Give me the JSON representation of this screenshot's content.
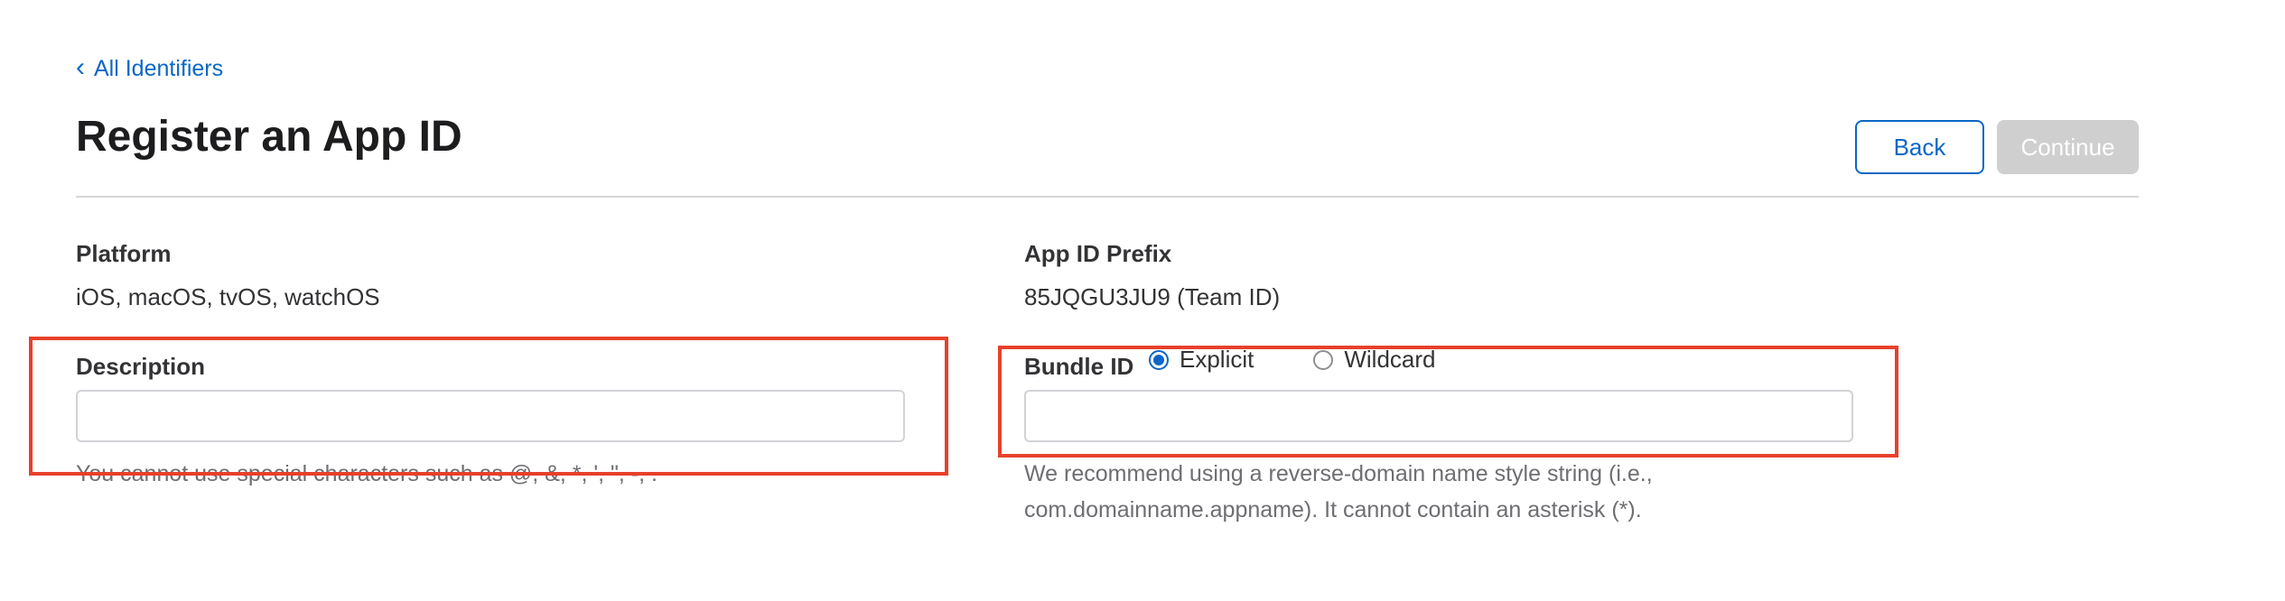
{
  "nav": {
    "back_link": "All Identifiers",
    "chevron": "‹"
  },
  "page": {
    "title": "Register an App ID"
  },
  "actions": {
    "back_label": "Back",
    "continue_label": "Continue"
  },
  "platform": {
    "label": "Platform",
    "value": "iOS, macOS, tvOS, watchOS"
  },
  "app_id_prefix": {
    "label": "App ID Prefix",
    "value": "85JQGU3JU9 (Team ID)"
  },
  "description": {
    "label": "Description",
    "value": "",
    "hint": "You cannot use special characters such as @, &, *, ', \", -, ."
  },
  "bundle_id": {
    "label": "Bundle ID",
    "options": [
      "Explicit",
      "Wildcard"
    ],
    "selected": "Explicit",
    "value": "",
    "hint_line1": "We recommend using a reverse-domain name style string (i.e.,",
    "hint_line2": "com.domainname.appname). It cannot contain an asterisk (*)."
  },
  "colors": {
    "accent": "#0b67c7",
    "highlight": "#e8402b",
    "disabled": "#cfcfcf"
  }
}
